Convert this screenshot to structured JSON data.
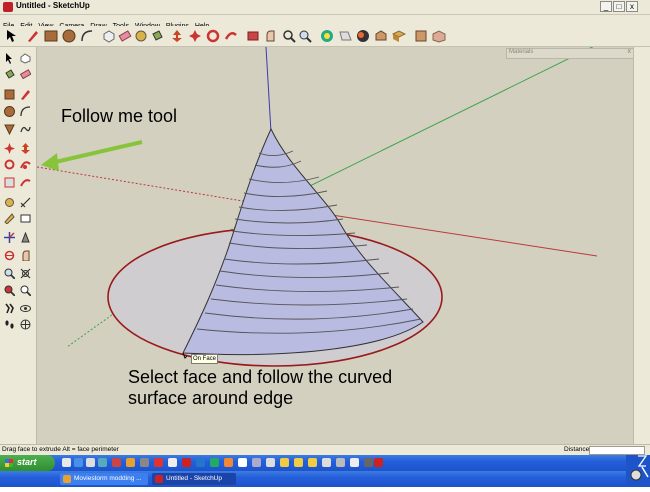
{
  "window": {
    "title": "Untitled - SketchUp",
    "minimize": "_",
    "maximize": "□",
    "close": "x"
  },
  "menu": [
    "File",
    "Edit",
    "View",
    "Camera",
    "Draw",
    "Tools",
    "Window",
    "Plugins",
    "Help"
  ],
  "toolbar_icons": [
    "select-icon",
    "pencil-icon",
    "rectangle-icon",
    "circle-icon",
    "arc-icon",
    "make-component-icon",
    "eraser-icon",
    "tape-measure-icon",
    "paint-bucket-icon",
    "push-pull-icon",
    "rotate-icon",
    "follow-me-icon",
    "offset-icon",
    "move-icon",
    "orbit-icon",
    "pan-icon",
    "zoom-icon",
    "zoom-extents-icon",
    "previous-view-icon",
    "next-view-icon",
    "3d-warehouse-icon",
    "share-model-icon",
    "get-models-icon",
    "components-icon"
  ],
  "materials_panel": {
    "title": "Materials",
    "close": "x"
  },
  "annotations": {
    "follow_me": "Follow me tool",
    "instruction_line1": "Select face and follow the curved",
    "instruction_line2": "surface around edge",
    "tooltip": "On Face"
  },
  "status": {
    "hint": "Drag face to extrude  Alt = face perimeter",
    "distance_label": "Distance",
    "distance_value": ""
  },
  "taskbar": {
    "start": "start",
    "tasks": [
      "Moviestorm modding ...",
      "Untitled - SketchUp"
    ]
  },
  "colors": {
    "viewport_bg": "#d4d0c0",
    "cone_fill": "#b9bbe1",
    "circle_stroke": "#9a1a1a",
    "axis_red": "#b73a3a",
    "axis_green": "#3aa34a",
    "axis_blue": "#3a3ab0",
    "arrow": "#88c43a",
    "taskbar": "#245edb",
    "start_button": "#3c9a3c"
  }
}
